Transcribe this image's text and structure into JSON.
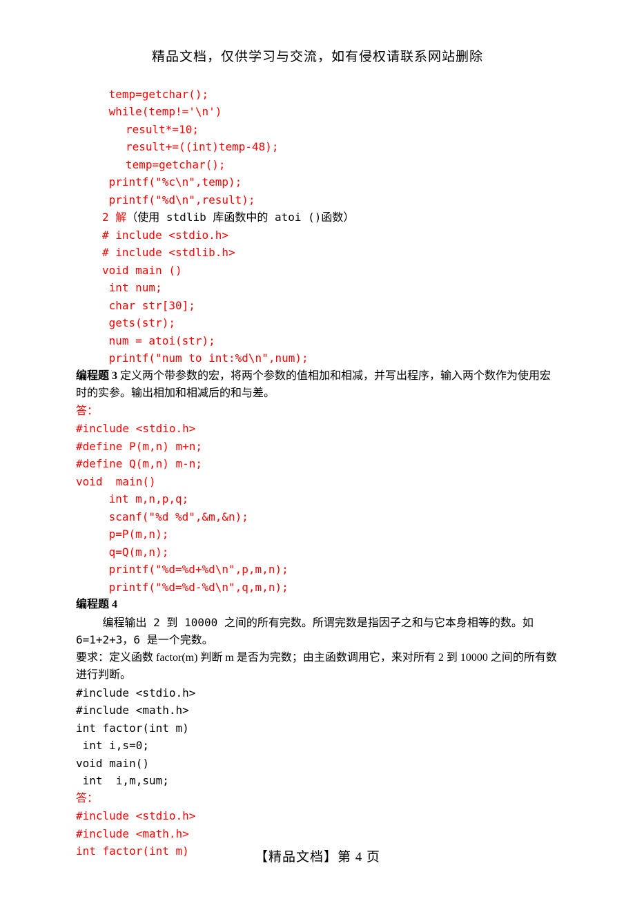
{
  "header": "精品文档，仅供学习与交流，如有侵权请联系网站删除",
  "footer": "【精品文档】第 4 页",
  "block1": {
    "l1": " temp=getchar();",
    "l2": " while(temp!='\\n')",
    "l3": "result*=10;",
    "l4": "result+=((int)temp-48);",
    "l5": "temp=getchar();",
    "l6": " printf(\"%c\\n\",temp);",
    "l7": " printf(\"%d\\n\",result);",
    "l8a": "2 解",
    "l8b": "（使用 stdlib 库函数中的 atoi ()函数）",
    "l9": "# include <stdio.h>",
    "l10": "# include <stdlib.h>",
    "l11": "void main ()",
    "l12": " int num;",
    "l13": " char str[30];",
    "l14": " gets(str);",
    "l15": " num = atoi(str);",
    "l16": " printf(\"num to int:%d\\n\",num);"
  },
  "q3": {
    "title": "编程题 3",
    "desc": " 定义两个带参数的宏，将两个参数的值相加和相减，并写出程序，输入两个数作为使用宏时的实参。输出相加和相减后的和与差。",
    "ans_label": "答：",
    "c1": "#include <stdio.h>",
    "c2": "#define P(m,n) m+n;",
    "c3": "#define Q(m,n) m-n;",
    "c4": "void  main()",
    "c5": " int m,n,p,q;",
    "c6": " scanf(\"%d %d\",&m,&n);",
    "c7": " p=P(m,n);",
    "c8": " q=Q(m,n);",
    "c9": " printf(\"%d=%d+%d\\n\",p,m,n);",
    "c10": " printf(\"%d=%d-%d\\n\",q,m,n);"
  },
  "q4": {
    "title": "编程题 4",
    "p1": "    编程输出 2 到 10000 之间的所有完数。所谓完数是指因子之和与它本身相等的数。如6=1+2+3，6 是一个完数。",
    "p2": "要求：定义函数 factor(m) 判断 m 是否为完数；由主函数调用它，来对所有 2 到 10000 之间的所有数进行判断。",
    "c1": "#include <stdio.h>",
    "c2": "#include <math.h>",
    "c3": "int factor(int m)",
    "c4": " int i,s=0;",
    "c5": "void main()",
    "c6": " int  i,m,sum;",
    "ans_label": "答：",
    "a1": "#include <stdio.h>",
    "a2": "#include <math.h>",
    "a3": "int factor(int m)"
  }
}
